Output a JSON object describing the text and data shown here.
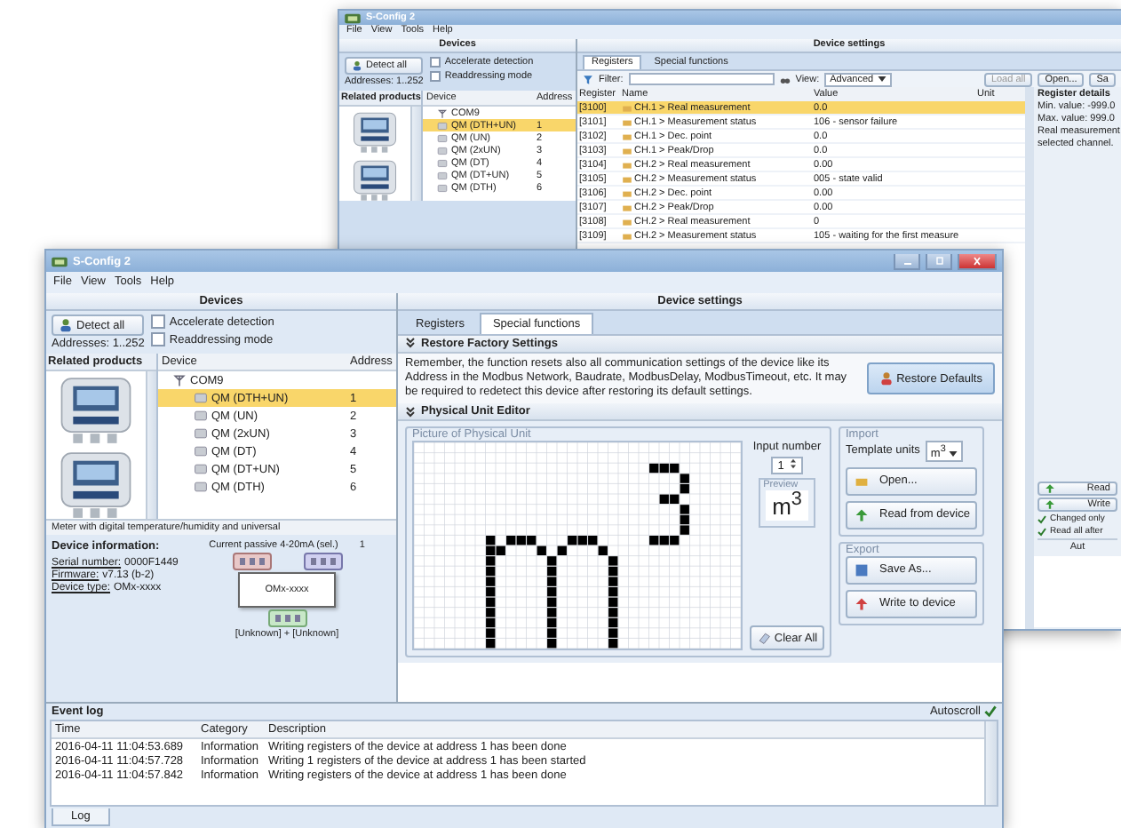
{
  "back_window": {
    "title": "S-Config 2",
    "menu": [
      "File",
      "View",
      "Tools",
      "Help"
    ],
    "devices": {
      "header": "Devices",
      "detect_button": "Detect all",
      "addresses": "Addresses: 1..252",
      "options": [
        {
          "label": "Accelerate detection",
          "checked": false
        },
        {
          "label": "Readdressing mode",
          "checked": false
        }
      ],
      "related_header": "Related products",
      "columns": [
        "Device",
        "Address"
      ],
      "port": "COM9",
      "items": [
        {
          "name": "QM (DTH+UN)",
          "address": "1",
          "selected": true
        },
        {
          "name": "QM (UN)",
          "address": "2",
          "selected": false
        },
        {
          "name": "QM (2xUN)",
          "address": "3",
          "selected": false
        },
        {
          "name": "QM (DT)",
          "address": "4",
          "selected": false
        },
        {
          "name": "QM (DT+UN)",
          "address": "5",
          "selected": false
        },
        {
          "name": "QM (DTH)",
          "address": "6",
          "selected": false
        }
      ]
    },
    "settings": {
      "header": "Device settings",
      "tabs": [
        {
          "label": "Registers",
          "selected": true
        },
        {
          "label": "Special functions",
          "selected": false
        }
      ],
      "filter_label": "Filter:",
      "view_label": "View:",
      "view_value": "Advanced",
      "toolbar_buttons": [
        {
          "label": "Load all",
          "disabled": true
        },
        {
          "label": "Open...",
          "disabled": false
        },
        {
          "label": "Sa",
          "disabled": false
        }
      ],
      "columns": [
        "Register",
        "Name",
        "Value",
        "Unit"
      ],
      "rows": [
        {
          "register": "[3100]",
          "name": "CH.1 > Real measurement",
          "value": "0.0",
          "selected": true
        },
        {
          "register": "[3101]",
          "name": "CH.1 > Measurement status",
          "value": "106 - sensor failure",
          "selected": false
        },
        {
          "register": "[3102]",
          "name": "CH.1 > Dec. point",
          "value": "0.0",
          "selected": false
        },
        {
          "register": "[3103]",
          "name": "CH.1 > Peak/Drop",
          "value": "0.0",
          "selected": false
        },
        {
          "register": "[3104]",
          "name": "CH.2 > Real measurement",
          "value": "0.00",
          "selected": false
        },
        {
          "register": "[3105]",
          "name": "CH.2 > Measurement status",
          "value": "005 - state valid",
          "selected": false
        },
        {
          "register": "[3106]",
          "name": "CH.2 > Dec. point",
          "value": "0.00",
          "selected": false
        },
        {
          "register": "[3107]",
          "name": "CH.2 > Peak/Drop",
          "value": "0.00",
          "selected": false
        },
        {
          "register": "[3108]",
          "name": "CH.2 > Real measurement",
          "value": "0",
          "selected": false
        },
        {
          "register": "[3109]",
          "name": "CH.2 > Measurement status",
          "value": "105 - waiting for the first measure",
          "selected": false
        }
      ],
      "details": {
        "title": "Register details",
        "lines": [
          "Min. value: -999.0",
          "Max. value: 999.0",
          "Real measurement",
          "selected channel."
        ]
      },
      "actions": [
        "Read",
        "Write"
      ],
      "options": [
        {
          "label": "Changed only",
          "checked": true
        },
        {
          "label": "Read all after",
          "checked": true
        }
      ],
      "autoscroll": "Aut"
    }
  },
  "front_window": {
    "title": "S-Config 2",
    "menu": [
      "File",
      "View",
      "Tools",
      "Help"
    ],
    "devices": {
      "header": "Devices",
      "detect_button": "Detect all",
      "addresses": "Addresses: 1..252",
      "options": [
        {
          "label": "Accelerate detection",
          "checked": false
        },
        {
          "label": "Readdressing mode",
          "checked": false
        }
      ],
      "related_header": "Related products",
      "columns": [
        "Device",
        "Address"
      ],
      "port": "COM9",
      "items": [
        {
          "name": "QM (DTH+UN)",
          "address": "1",
          "selected": true
        },
        {
          "name": "QM (UN)",
          "address": "2",
          "selected": false
        },
        {
          "name": "QM (2xUN)",
          "address": "3",
          "selected": false
        },
        {
          "name": "QM (DT)",
          "address": "4",
          "selected": false
        },
        {
          "name": "QM (DT+UN)",
          "address": "5",
          "selected": false
        },
        {
          "name": "QM (DTH)",
          "address": "6",
          "selected": false
        }
      ],
      "caption": "Meter with digital temperature/humidity and universal",
      "info": {
        "title": "Device information:",
        "fields": [
          {
            "label": "Serial number:",
            "value": "0000F1449"
          },
          {
            "label": "Firmware:",
            "value": "v7.13 (b-2)"
          },
          {
            "label": "Device type:",
            "value": "OMx-xxxx"
          }
        ],
        "diagram": {
          "input_label": "Current passive 4-20mA (sel.)",
          "channel": "1",
          "device": "OMx-xxxx",
          "output_label": "[Unknown] + [Unknown]"
        }
      }
    },
    "settings": {
      "header": "Device settings",
      "tabs": [
        {
          "label": "Registers",
          "selected": false
        },
        {
          "label": "Special functions",
          "selected": true
        }
      ],
      "restore": {
        "title": "Restore Factory Settings",
        "text": "Remember, the function resets also all communication settings of the device like its Address in the Modbus Network, Baudrate, ModbusDelay, ModbusTimeout, etc. It may be required to redetect this device after restoring its default settings.",
        "button": "Restore Defaults"
      },
      "editor": {
        "title": "Physical Unit Editor",
        "picture_label": "Picture of Physical Unit",
        "input_label": "Input number",
        "input_value": "1",
        "preview_label": "Preview",
        "preview": "m$^{3}$",
        "clear_button": "Clear All",
        "import": {
          "title": "Import",
          "template_label": "Template units",
          "template_value": "m$^{3}$",
          "buttons": [
            "Open...",
            "Read from device"
          ]
        },
        "export": {
          "title": "Export",
          "buttons": [
            "Save As...",
            "Write to device"
          ]
        }
      }
    },
    "event_log": {
      "title": "Event log",
      "autoscroll": {
        "label": "Autoscroll",
        "checked": true
      },
      "columns": [
        "Time",
        "Category",
        "Description"
      ],
      "rows": [
        {
          "time": "2016-04-11 11:04:53.689",
          "category": "Information",
          "description": "Writing registers of the device at address 1 has been done"
        },
        {
          "time": "2016-04-11 11:04:57.728",
          "category": "Information",
          "description": "Writing 1 registers of the device at address 1 has been started"
        },
        {
          "time": "2016-04-11 11:04:57.842",
          "category": "Information",
          "description": "Writing registers of the device at address 1 has been done"
        }
      ],
      "tabs": [
        {
          "label": "Log",
          "selected": true
        }
      ]
    }
  }
}
